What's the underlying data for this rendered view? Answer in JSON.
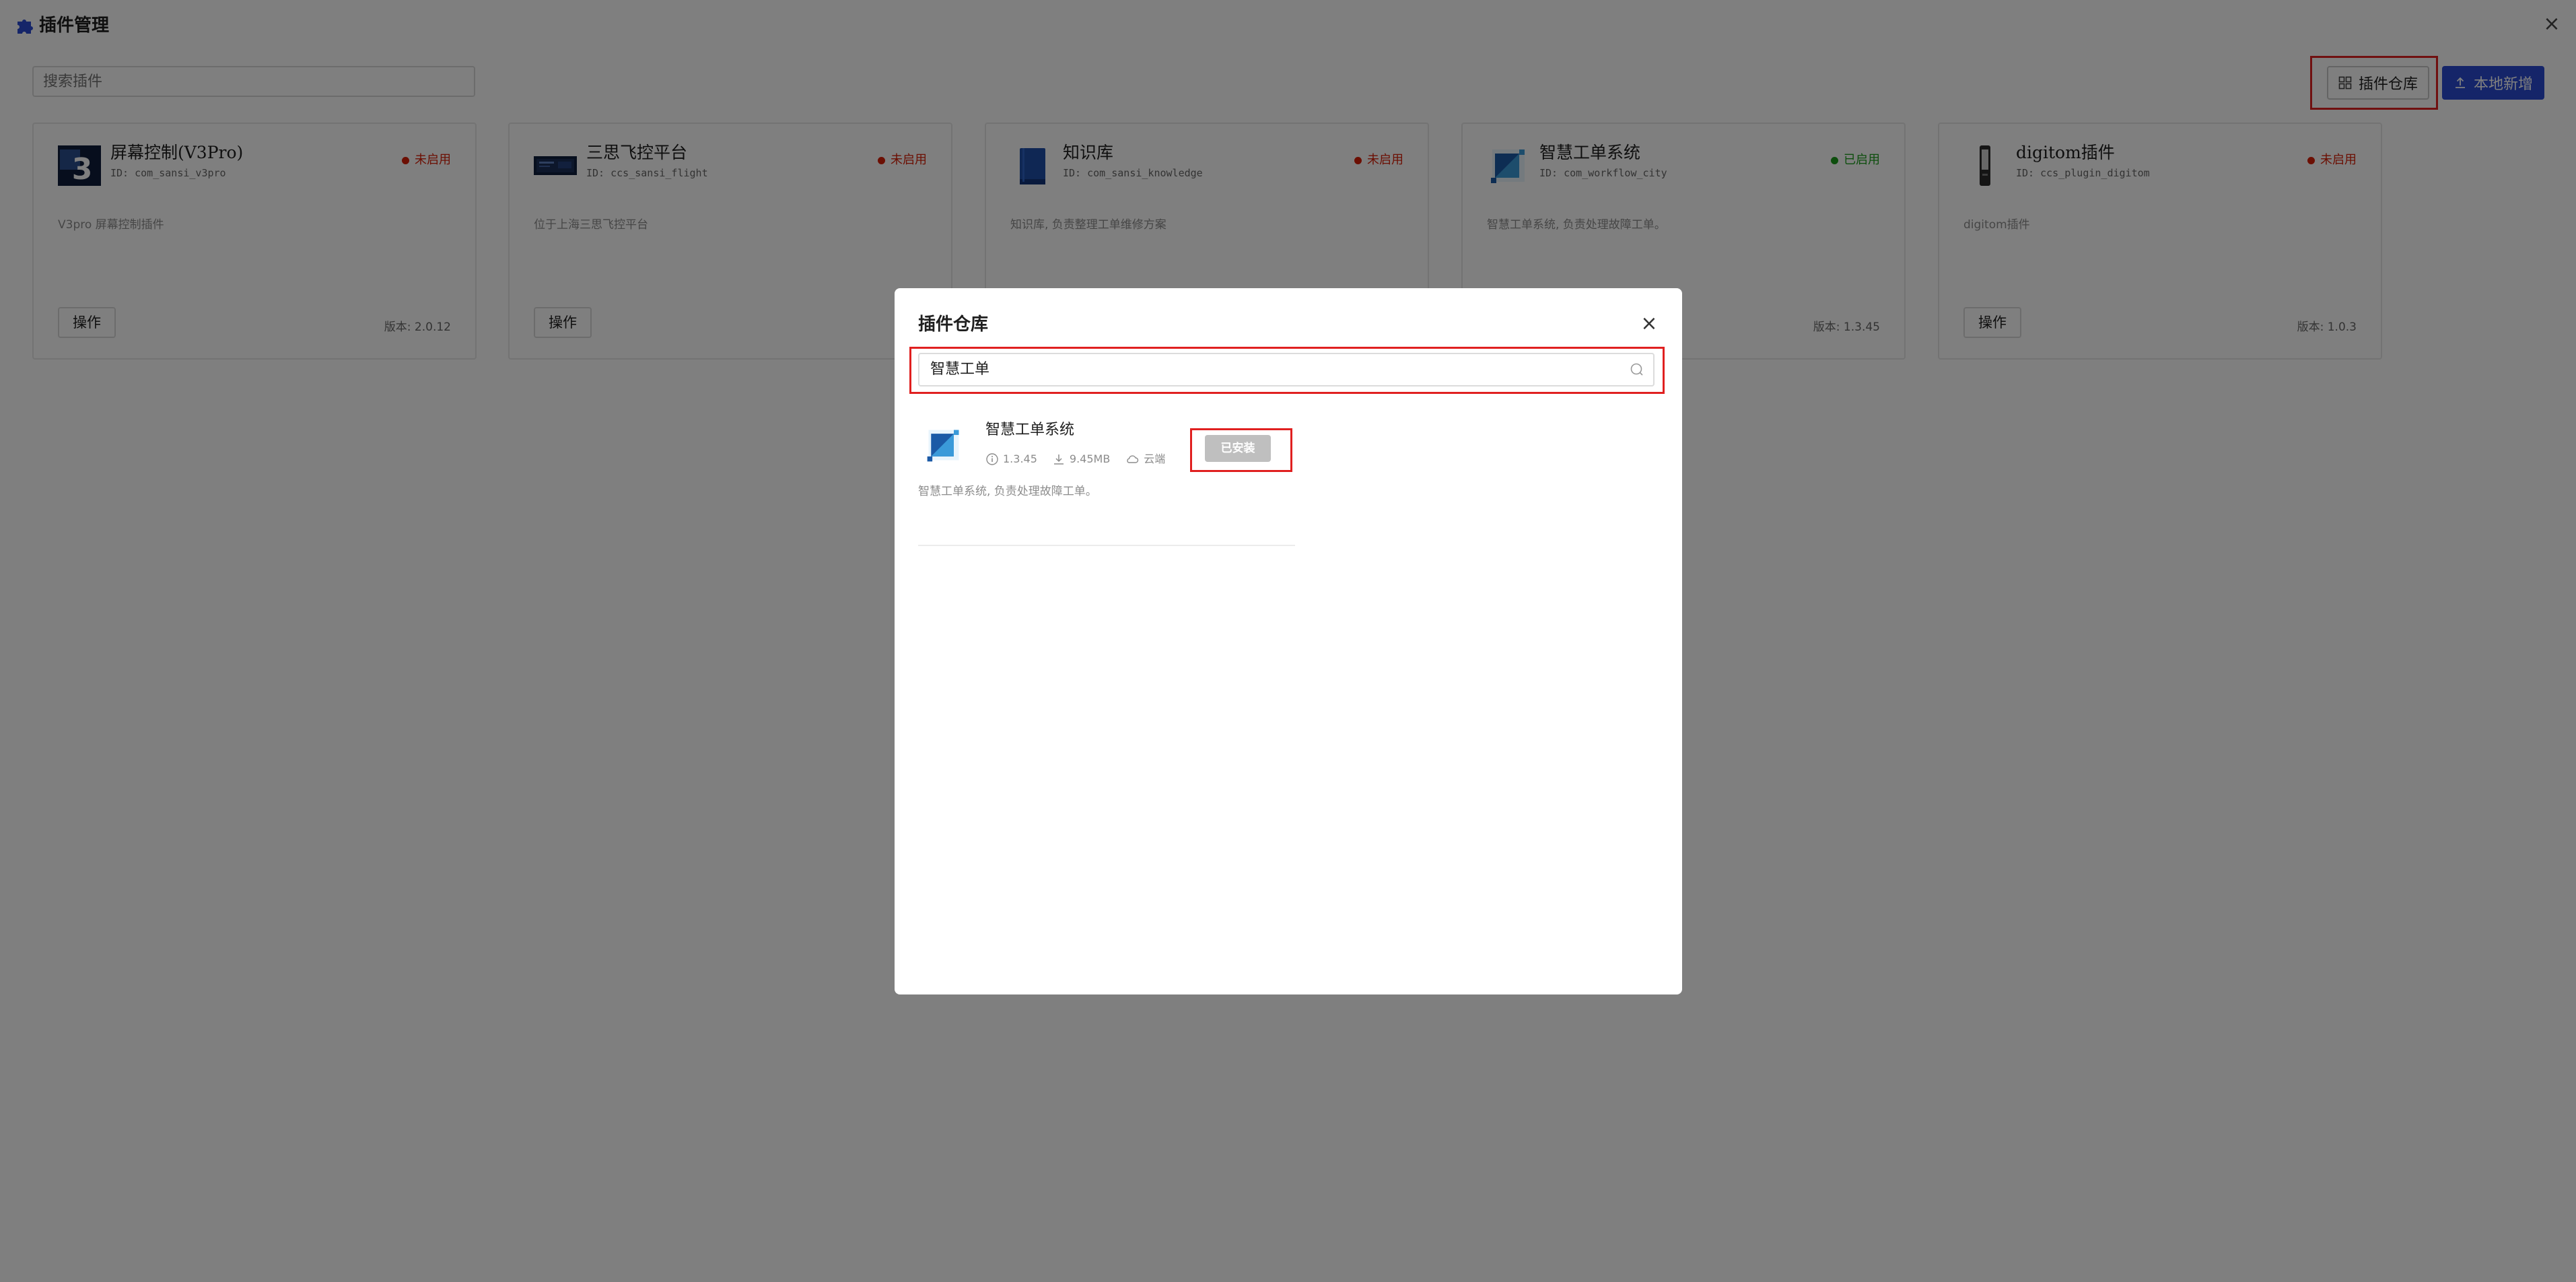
{
  "header": {
    "title": "插件管理",
    "logo_icon": "puzzle-icon",
    "close_icon": "close-icon",
    "search": {
      "placeholder": "搜索插件"
    },
    "store_button": {
      "label": "插件仓库",
      "icon": "grid-icon"
    },
    "local_add_button": {
      "label": "本地新增",
      "icon": "upload-icon"
    }
  },
  "colors": {
    "brand": "#2b4bd3",
    "status_disabled": "#d81e06",
    "status_enabled": "#1a9d1a",
    "highlight": "#e02020"
  },
  "cards": [
    {
      "name": "屏幕控制(V3Pro)",
      "id": "ID: com_sansi_v3pro",
      "status": "未启用",
      "status_color": "#d81e06",
      "description": "V3pro 屏幕控制插件",
      "action_label": "操作",
      "version": "版本: 2.0.12",
      "icon": "v3-icon"
    },
    {
      "name": "三思飞控平台",
      "id": "ID: ccs_sansi_flight",
      "status": "未启用",
      "status_color": "#d81e06",
      "description": "位于上海三思飞控平台",
      "action_label": "操作",
      "version": "",
      "icon": "screen-icon"
    },
    {
      "name": "知识库",
      "id": "ID: com_sansi_knowledge",
      "status": "未启用",
      "status_color": "#d81e06",
      "description": "知识库, 负责整理工单维修方案",
      "action_label": "",
      "version": "",
      "icon": "book-icon"
    },
    {
      "name": "智慧工单系统",
      "id": "ID: com_workflow_city",
      "status": "已启用",
      "status_color": "#1a9d1a",
      "description": "智慧工单系统, 负责处理故障工单。",
      "action_label": "",
      "version": "版本: 1.3.45",
      "icon": "workorder-icon"
    },
    {
      "name": "digitom插件",
      "id": "ID: ccs_plugin_digitom",
      "status": "未启用",
      "status_color": "#d81e06",
      "description": "digitom插件",
      "action_label": "操作",
      "version": "版本: 1.0.3",
      "icon": "device-icon"
    }
  ],
  "modal": {
    "title": "插件仓库",
    "close_icon": "close-icon",
    "search": {
      "value": "智慧工单",
      "icon": "search-icon"
    },
    "results": [
      {
        "name": "智慧工单系统",
        "version": "1.3.45",
        "size": "9.45MB",
        "source": "云端",
        "status_label": "已安装",
        "description": "智慧工单系统, 负责处理故障工单。",
        "icon": "workorder-icon"
      }
    ]
  }
}
